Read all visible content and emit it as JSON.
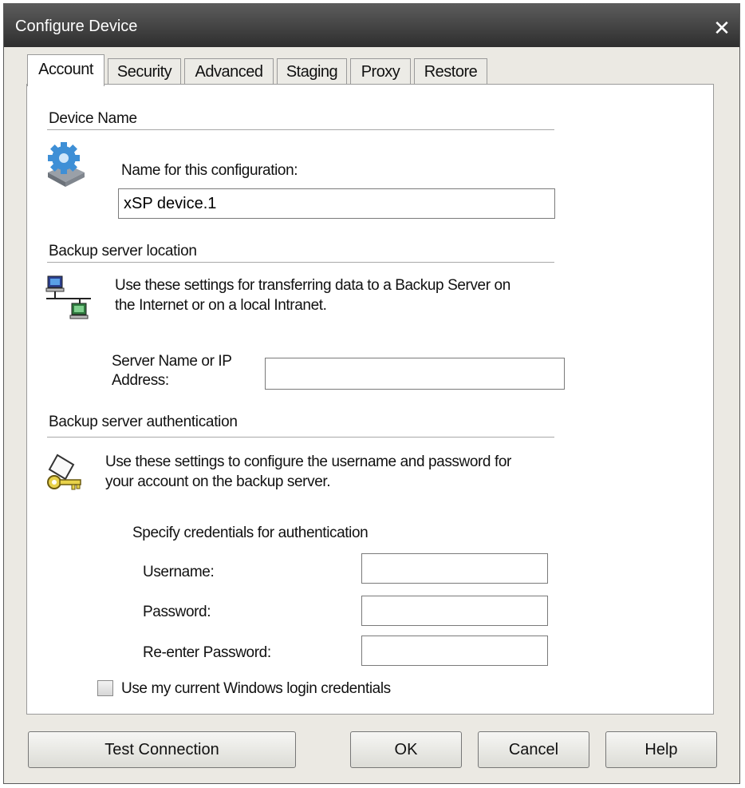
{
  "window": {
    "title": "Configure Device"
  },
  "tabs": [
    {
      "label": "Account"
    },
    {
      "label": "Security"
    },
    {
      "label": "Advanced"
    },
    {
      "label": "Staging"
    },
    {
      "label": "Proxy"
    },
    {
      "label": "Restore"
    }
  ],
  "device_name": {
    "heading": "Device Name",
    "field_label": "Name for this configuration:",
    "value": "xSP device.1",
    "icon": "gear-device-icon"
  },
  "server_location": {
    "heading": "Backup server location",
    "description_line1": "Use these settings for transferring data to a Backup Server on",
    "description_line2": "the Internet or on a local Intranet.",
    "field_label_line1": "Server Name or IP",
    "field_label_line2": "Address:",
    "value": "",
    "icon": "network-computers-icon"
  },
  "authentication": {
    "heading": "Backup server authentication",
    "description_line1": "Use these settings to configure the username and password for",
    "description_line2": "your account on the backup server.",
    "credentials_heading": "Specify credentials for authentication",
    "username_label": "Username:",
    "username_value": "",
    "password_label": "Password:",
    "password_value": "",
    "reenter_label": "Re-enter Password:",
    "reenter_value": "",
    "windows_login_label": "Use my current Windows login credentials",
    "windows_login_checked": false,
    "icon": "key-icon"
  },
  "buttons": {
    "test_connection": "Test Connection",
    "ok": "OK",
    "cancel": "Cancel",
    "help": "Help"
  },
  "colors": {
    "titlebar": "#3a3a3a",
    "dialog_bg": "#ebe9e3",
    "panel_bg": "#ffffff"
  }
}
